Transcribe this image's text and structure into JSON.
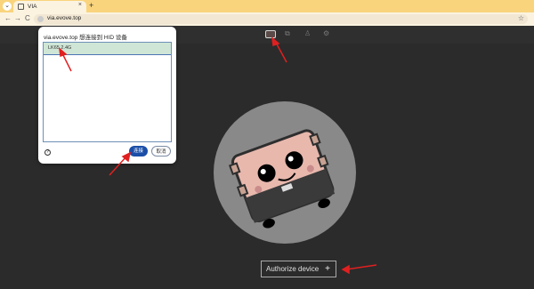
{
  "browser": {
    "tab_title": "VIA",
    "new_tab": "+",
    "tab_close": "×",
    "url": "via.evove.top",
    "back": "←",
    "forward": "→",
    "reload": "C",
    "bookmark_star": "☆"
  },
  "dialog": {
    "title": "via.evove.top 想连接到 HID 设备",
    "device_name": "LK65 2.4G",
    "connect_label": "连接",
    "cancel_label": "取消",
    "help_icon": "?"
  },
  "app": {
    "authorize_label": "Authorize device",
    "authorize_plus": "+"
  },
  "annotation": {
    "arrow_color": "#e02020"
  },
  "icons": {
    "keyboard": "keyboard-icon",
    "settings": "gear-icon"
  }
}
